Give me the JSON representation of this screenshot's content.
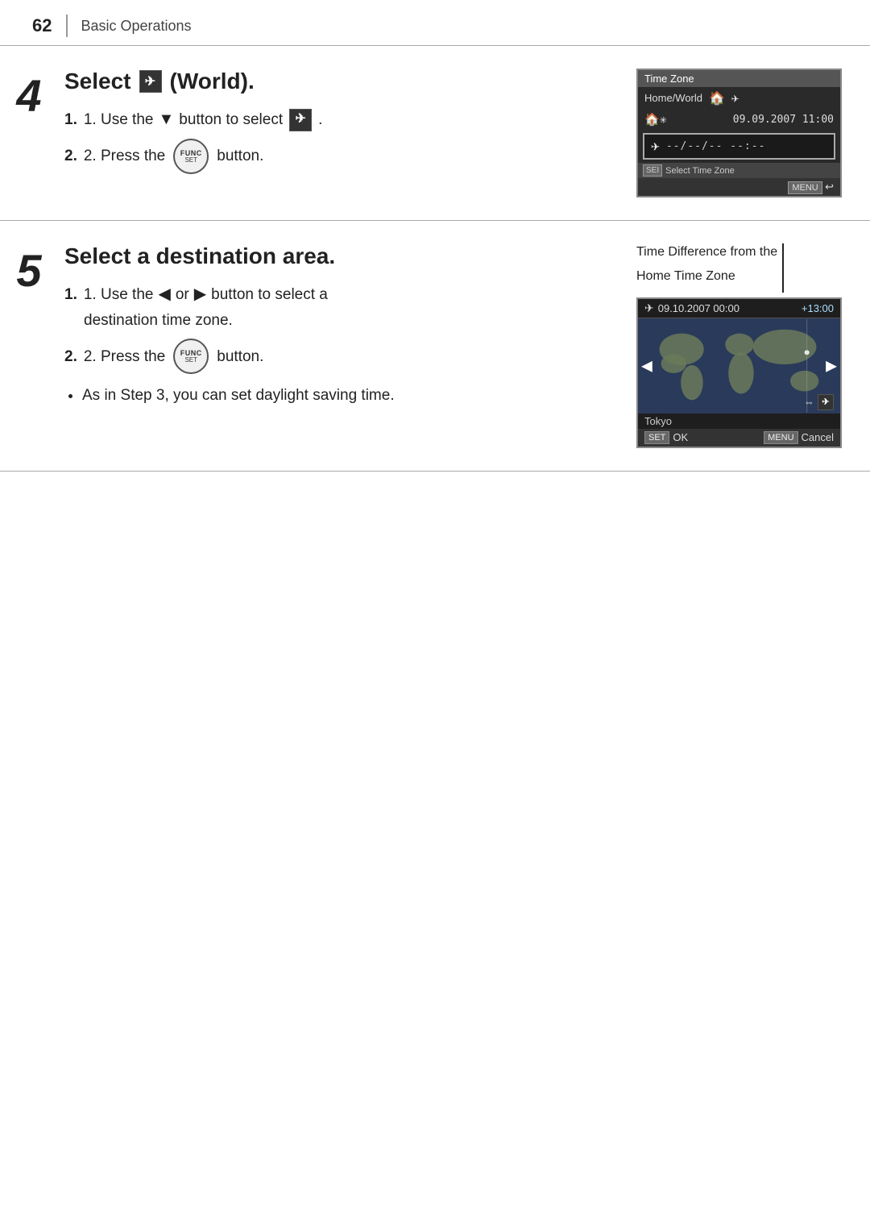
{
  "header": {
    "page_number": "62",
    "section": "Basic Operations"
  },
  "step4": {
    "number": "4",
    "title": "Select",
    "title_icon": "world-icon",
    "title_suffix": "(World).",
    "instruction1_prefix": "1. Use the",
    "instruction1_arrow": "▼",
    "instruction1_suffix": "button to select",
    "instruction1_icon": "world-icon",
    "instruction1_end": ".",
    "instruction2_prefix": "2. Press the",
    "instruction2_button": "FUNC/SET",
    "instruction2_suffix": "button.",
    "screen": {
      "title": "Time Zone",
      "row1_label": "Home/World",
      "row1_icon1": "🏠",
      "row1_icon2": "✈",
      "row2_icon": "🏠✳",
      "row2_date": "09.09.2007 11:00",
      "highlighted_icon": "✈",
      "highlighted_date": "--/--/-- --:--",
      "hint": "SEI Select Time Zone",
      "menu_text": "MENU ↩"
    }
  },
  "step5": {
    "number": "5",
    "title": "Select a destination area.",
    "instruction1_prefix": "1. Use the",
    "instruction1_left": "◀",
    "instruction1_or": "or",
    "instruction1_right": "▶",
    "instruction1_suffix": "button to select a",
    "instruction1_line2": "destination time zone.",
    "instruction2_prefix": "2. Press the",
    "instruction2_button": "FUNC/SET",
    "instruction2_suffix": "button.",
    "bullet1": "As in Step 3, you can set daylight saving time.",
    "caption_line1": "Time Difference from the",
    "caption_line2": "Home Time Zone",
    "screen": {
      "topbar_icon": "✈",
      "topbar_date": "09.10.2007 00:00",
      "topbar_diff": "+13:00",
      "city": "Tokyo",
      "set_label": "SET",
      "set_text": "OK",
      "menu_label": "MENU",
      "menu_text": "Cancel"
    }
  }
}
